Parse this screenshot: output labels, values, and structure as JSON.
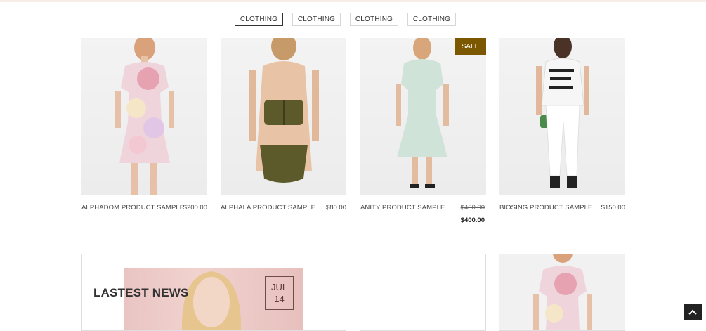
{
  "tabs": [
    "CLOTHING",
    "CLOTHING",
    "CLOTHING",
    "CLOTHING"
  ],
  "products": [
    {
      "name": "ALPHADOM PRODUCT SAMPLE",
      "price": "$200.00"
    },
    {
      "name": "ALPHALA PRODUCT SAMPLE",
      "price": "$80.00"
    },
    {
      "name": "ANITY PRODUCT SAMPLE",
      "old_price": "$450.00",
      "new_price": "$400.00",
      "badge": "SALE"
    },
    {
      "name": "BIOSING PRODUCT SAMPLE",
      "price": "$150.00"
    }
  ],
  "news": {
    "title": "LASTEST NEWS",
    "month": "JUL",
    "day": "14"
  },
  "colors": {
    "sale_badge": "#7b5800",
    "active_tab_border": "#333333"
  },
  "icons": {
    "back_to_top": "chevron-up-icon"
  }
}
